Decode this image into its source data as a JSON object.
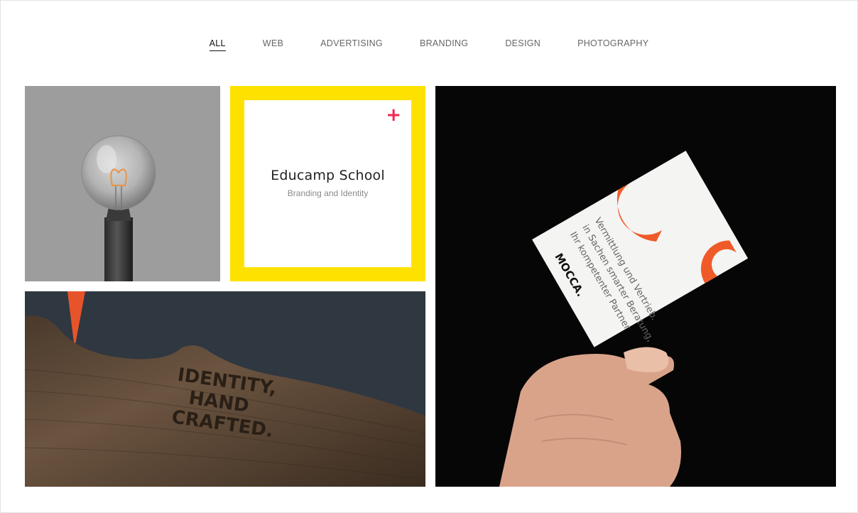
{
  "filters": [
    {
      "label": "ALL",
      "active": true
    },
    {
      "label": "WEB",
      "active": false
    },
    {
      "label": "ADVERTISING",
      "active": false
    },
    {
      "label": "BRANDING",
      "active": false
    },
    {
      "label": "DESIGN",
      "active": false
    },
    {
      "label": "PHOTOGRAPHY",
      "active": false
    }
  ],
  "portfolio": {
    "featured": {
      "title": "Educamp School",
      "subtitle": "Branding and Identity",
      "plus_icon": "+"
    },
    "wood_text": [
      "IDENTITY,",
      "HAND",
      "CRAFTED."
    ],
    "business_card": {
      "brand": "MOCCA.",
      "lines": [
        "Ihr kompetenter Partner",
        "in Sachen smarter Beratung,",
        "Vermittlung und Vertrieb."
      ]
    }
  },
  "colors": {
    "accent_yellow": "#ffe100",
    "plus_red": "#f0294f",
    "card_orange": "#f05a28"
  }
}
